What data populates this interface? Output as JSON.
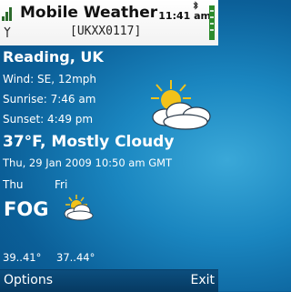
{
  "app": {
    "title": "Mobile Weather",
    "station_code": "[UKXX0117]",
    "clock": "11:41 am"
  },
  "status_icons": [
    "signal-icon",
    "bluetooth-icon",
    "battery-icon"
  ],
  "weather": {
    "location": "Reading, UK",
    "wind": "Wind: SE, 12mph",
    "sunrise": "Sunrise: 7:46 am",
    "sunset": "Sunset: 4:49 pm",
    "current": "37°F, Mostly Cloudy",
    "observed": "Thu, 29 Jan 2009 10:50 am GMT",
    "current_icon": "sun-cloud-icon"
  },
  "forecast": [
    {
      "day": "Thu",
      "condition_text": "FOG",
      "range": "39..41°"
    },
    {
      "day": "Fri",
      "condition_icon": "sun-cloud-icon",
      "range": "37..44°"
    }
  ],
  "softkeys": {
    "left": "Options",
    "right": "Exit"
  },
  "colors": {
    "background": "#1a86c0",
    "topbar": "#ffffff",
    "softbar": "#0c4e7e",
    "text": "#ffffff",
    "sun": "#f2c21a"
  }
}
